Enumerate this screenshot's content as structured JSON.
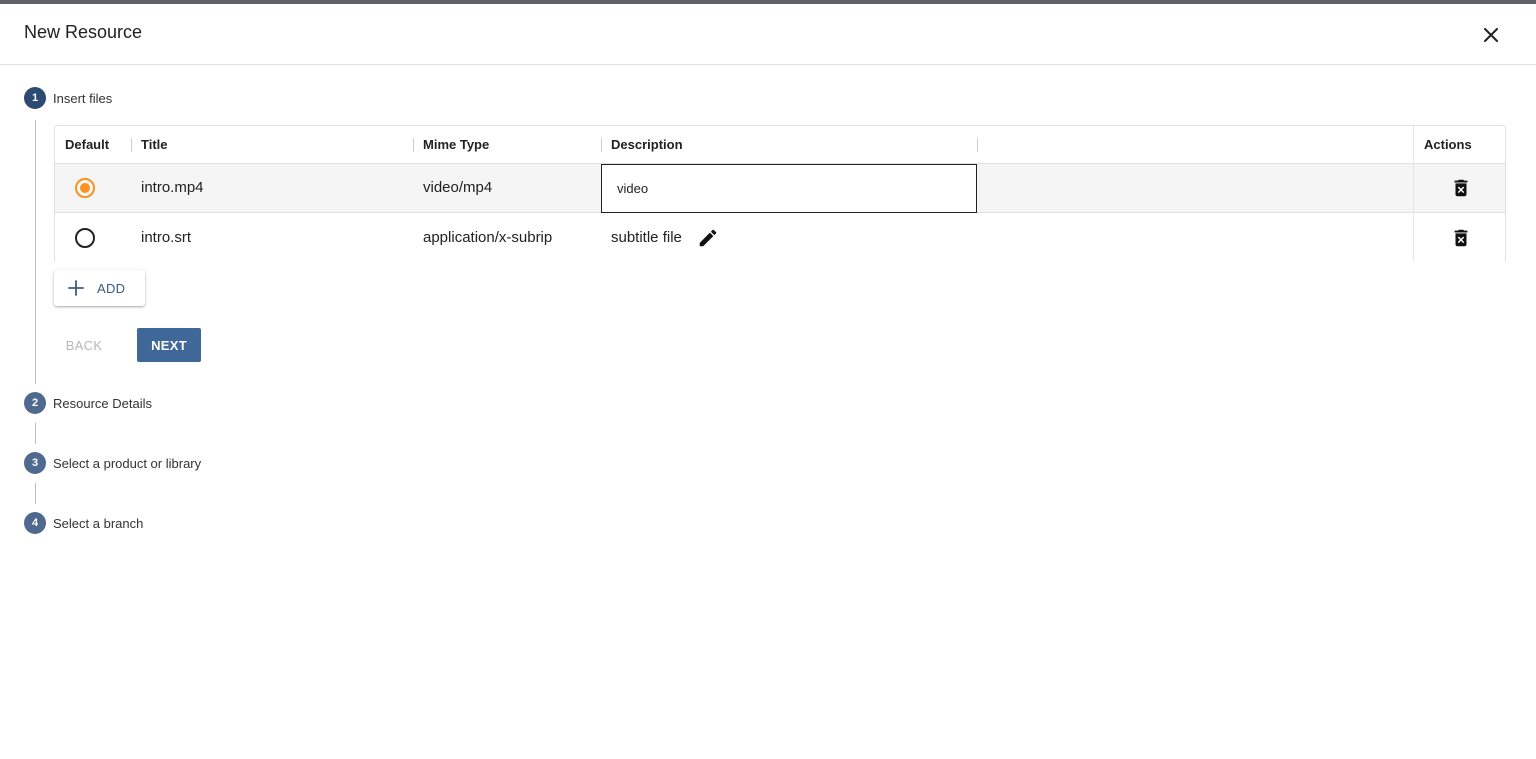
{
  "dialog": {
    "title": "New Resource",
    "close_icon": "close-icon"
  },
  "steps": [
    {
      "number": "1",
      "label": "Insert files",
      "active": true
    },
    {
      "number": "2",
      "label": "Resource Details",
      "active": false
    },
    {
      "number": "3",
      "label": "Select a product or library",
      "active": false
    },
    {
      "number": "4",
      "label": "Select a branch",
      "active": false
    }
  ],
  "table": {
    "headers": {
      "default": "Default",
      "title": "Title",
      "mime_type": "Mime Type",
      "description": "Description",
      "actions": "Actions"
    },
    "rows": [
      {
        "default": true,
        "title": "intro.mp4",
        "mime_type": "video/mp4",
        "description": "video",
        "editing": true
      },
      {
        "default": false,
        "title": "intro.srt",
        "mime_type": "application/x-subrip",
        "description": "subtitle file",
        "editing": false
      }
    ]
  },
  "buttons": {
    "add": "ADD",
    "back": "BACK",
    "next": "NEXT"
  },
  "colors": {
    "accent": "#3f6898",
    "radio_selected": "#f7931e",
    "step_circle": "#506a8f"
  }
}
